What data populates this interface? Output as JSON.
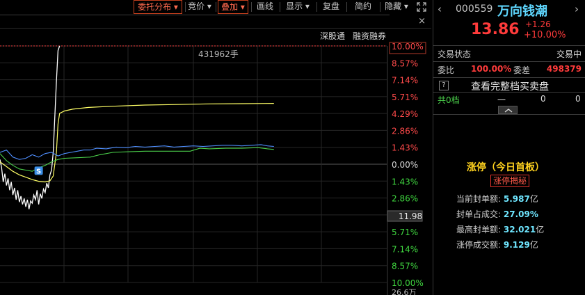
{
  "toolbar": {
    "items": [
      {
        "label": "委托分布 ▾",
        "active": true
      },
      {
        "label": "竞价 ▾",
        "active": false
      },
      {
        "label": "叠加 ▾",
        "active": true
      },
      {
        "label": "画线",
        "active": false
      },
      {
        "label": "显示 ▾",
        "active": false
      },
      {
        "label": "复盘",
        "active": false
      },
      {
        "label": "简约",
        "active": false
      },
      {
        "label": "隐藏 ▾",
        "active": false
      }
    ],
    "expand_icon": "expand-icon"
  },
  "subbar": {
    "close_label": "×",
    "link1": "深股通",
    "link2": "融资融券"
  },
  "chart_data": {
    "type": "line",
    "volume_label": "431962手",
    "price_marker": "11.98",
    "bottom_label": "26.6万",
    "marker_label": "S",
    "right_axis": [
      "10.00%",
      "8.57%",
      "7.14%",
      "5.71%",
      "4.29%",
      "2.86%",
      "1.43%",
      "0.00%",
      "1.43%",
      "2.86%",
      "4.29%",
      "5.71%",
      "7.14%",
      "8.57%",
      "10.00%"
    ],
    "ylim": [
      -10,
      10
    ],
    "colors": {
      "price": "#ffffff",
      "avg": "#ffff66",
      "blue": "#4f8fff",
      "green": "#4bd14b",
      "limit": "#ff4040"
    }
  },
  "quote": {
    "code": "000559",
    "name": "万向钱潮",
    "price": "13.86",
    "change": "+1.26",
    "change_pct": "+10.00%"
  },
  "status": {
    "label": "交易状态",
    "value": "交易中"
  },
  "ratio": {
    "label1": "委比",
    "value1": "100.00%",
    "label2": "委差",
    "value2": "498379"
  },
  "fullbook": {
    "icon": "?",
    "label": "查看完整档买卖盘"
  },
  "levels": {
    "label": "共0档",
    "col1": "一",
    "col2": "0",
    "col3": "0"
  },
  "limit_up": {
    "title": "涨停（今日首板）",
    "button": "涨停揭秘",
    "rows": [
      {
        "label": "当前封单额:",
        "value": "5.987",
        "unit": "亿"
      },
      {
        "label": "封单占成交:",
        "value": "27.09%",
        "unit": ""
      },
      {
        "label": "最高封单额:",
        "value": "32.021",
        "unit": "亿"
      },
      {
        "label": "涨停成交额:",
        "value": "9.129",
        "unit": "亿"
      }
    ]
  }
}
